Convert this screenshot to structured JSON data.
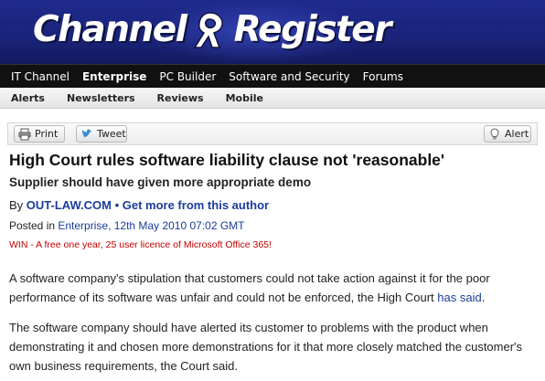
{
  "site": {
    "logo_left": "Channel",
    "logo_right": "Register"
  },
  "nav_primary": [
    {
      "label": "IT Channel",
      "active": false
    },
    {
      "label": "Enterprise",
      "active": true
    },
    {
      "label": "PC Builder",
      "active": false
    },
    {
      "label": "Software and Security",
      "active": false
    },
    {
      "label": "Forums",
      "active": false
    }
  ],
  "nav_secondary": [
    {
      "label": "Alerts"
    },
    {
      "label": "Newsletters"
    },
    {
      "label": "Reviews"
    },
    {
      "label": "Mobile"
    }
  ],
  "toolbar": {
    "print_label": "Print",
    "tweet_label": "Tweet",
    "alert_label": "Alert"
  },
  "article": {
    "headline": "High Court rules software liability clause not 'reasonable'",
    "subheadline": "Supplier should have given more appropriate demo",
    "by_prefix": "By ",
    "author": "OUT-LAW.COM",
    "byline_sep": " • ",
    "more_from_author": "Get more from this author",
    "posted_prefix": "Posted in ",
    "section": "Enterprise",
    "date": ", 12th May 2010 07:02 GMT",
    "promo": "WIN - A free one year, 25 user licence of Microsoft Office 365!",
    "para1_text": "A software company's stipulation that customers could not take action against it for the poor performance of its software was unfair and could not be enforced, the High Court ",
    "para1_link": "has said",
    "para1_end": ".",
    "para2_text": "The software company should have alerted its customer to problems with the product when demonstrating it and chosen more demonstrations for it that more closely matched the customer's own business requirements, the Court said."
  },
  "colors": {
    "masthead": "#1a237a",
    "nav_primary_bg": "#111111",
    "link": "#1b3c9b",
    "promo": "#c00000"
  }
}
